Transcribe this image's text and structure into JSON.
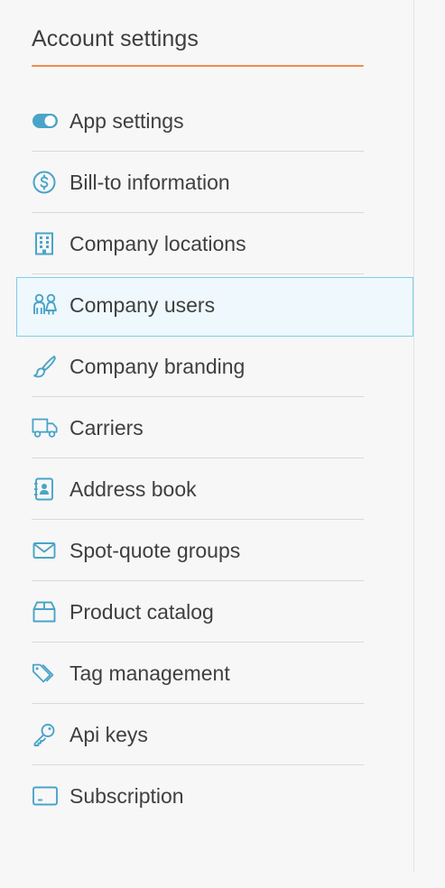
{
  "header": {
    "title": "Account settings"
  },
  "menu": {
    "items": [
      {
        "label": "App settings",
        "icon": "toggle-icon"
      },
      {
        "label": "Bill-to information",
        "icon": "dollar-circle-icon"
      },
      {
        "label": "Company locations",
        "icon": "building-icon"
      },
      {
        "label": "Company users",
        "icon": "users-icon",
        "active": true
      },
      {
        "label": "Company branding",
        "icon": "brush-icon"
      },
      {
        "label": "Carriers",
        "icon": "truck-icon"
      },
      {
        "label": "Address book",
        "icon": "address-book-icon"
      },
      {
        "label": "Spot-quote groups",
        "icon": "envelope-icon"
      },
      {
        "label": "Product catalog",
        "icon": "box-icon"
      },
      {
        "label": "Tag management",
        "icon": "tags-icon"
      },
      {
        "label": "Api keys",
        "icon": "key-icon"
      },
      {
        "label": "Subscription",
        "icon": "laptop-icon"
      }
    ]
  },
  "colors": {
    "accent": "#f08a4b",
    "icon": "#4aa4c8",
    "active_border": "#7fcfe8",
    "active_bg": "#eef8fd",
    "text": "#3f3f3f",
    "background": "#f7f7f7"
  }
}
